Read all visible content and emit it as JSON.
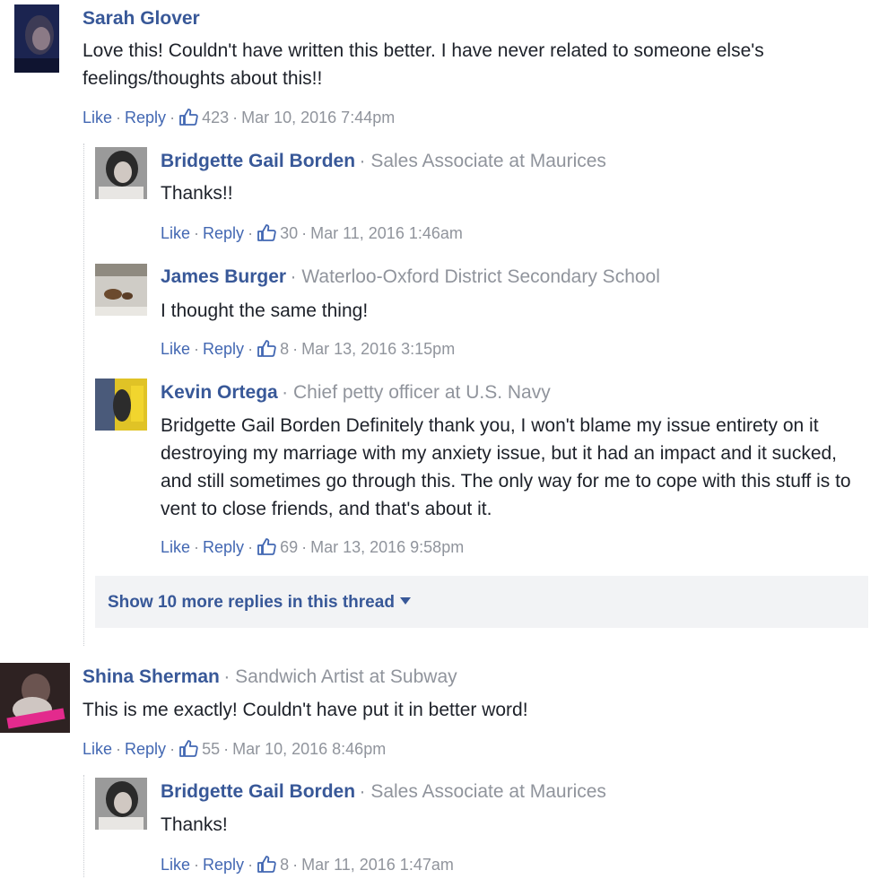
{
  "comments": [
    {
      "name": "Sarah Glover",
      "role": "",
      "text": "Love this! Couldn't have written this better. I have never related to someone else's feelings/thoughts about this!!",
      "like": "Like",
      "reply": "Reply",
      "likes": "423",
      "date": "Mar 10, 2016 7:44pm",
      "avatar_color": "#2b3a6b",
      "replies": [
        {
          "name": "Bridgette Gail Borden",
          "role": "Sales Associate at Maurices",
          "text": "Thanks!!",
          "like": "Like",
          "reply": "Reply",
          "likes": "30",
          "date": "Mar 11, 2016 1:46am",
          "avatar_color": "#7d7d7d"
        },
        {
          "name": "James Burger",
          "role": "Waterloo-Oxford District Secondary School",
          "text": "I thought the same thing!",
          "like": "Like",
          "reply": "Reply",
          "likes": "8",
          "date": "Mar 13, 2016 3:15pm",
          "avatar_color": "#b5b2ab"
        },
        {
          "name": "Kevin Ortega",
          "role": "Chief petty officer at U.S. Navy",
          "text": "Bridgette Gail Borden Definitely thank you, I won't blame my issue entirety on it destroying my marriage with my anxiety issue, but it had an impact and it sucked, and still sometimes go through this. The only way for me to cope with this stuff is to vent to close friends, and that's about it.",
          "like": "Like",
          "reply": "Reply",
          "likes": "69",
          "date": "Mar 13, 2016 9:58pm",
          "avatar_color": "#d7b51f"
        }
      ],
      "more_replies": "Show 10 more replies in this thread"
    },
    {
      "name": "Shina Sherman",
      "role": "Sandwich Artist at Subway",
      "text": "This is me exactly! Couldn't have put it in better word!",
      "like": "Like",
      "reply": "Reply",
      "likes": "55",
      "date": "Mar 10, 2016 8:46pm",
      "avatar_color": "#3a2a2a",
      "replies": [
        {
          "name": "Bridgette Gail Borden",
          "role": "Sales Associate at Maurices",
          "text": "Thanks!",
          "like": "Like",
          "reply": "Reply",
          "likes": "8",
          "date": "Mar 11, 2016 1:47am",
          "avatar_color": "#7d7d7d"
        }
      ]
    }
  ],
  "colors": {
    "name": "#385898",
    "link": "#4267b2",
    "muted": "#90949c",
    "more_bg": "#f2f3f5"
  }
}
